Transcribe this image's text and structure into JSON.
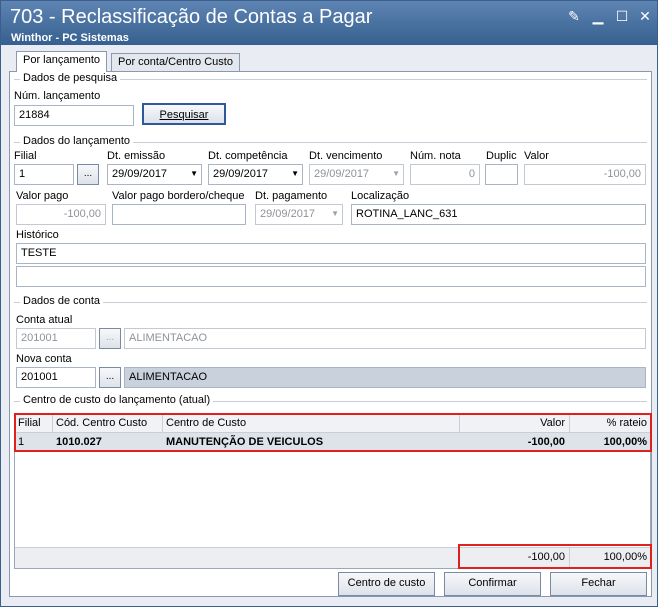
{
  "window": {
    "title": "703 - Reclassificação de Contas a Pagar",
    "subtitle": "Winthor - PC Sistemas"
  },
  "tabs": [
    {
      "label": "Por lançamento",
      "active": true
    },
    {
      "label": "Por conta/Centro Custo",
      "active": false
    }
  ],
  "pesquisa": {
    "group_label": "Dados de pesquisa",
    "num_lanc_label": "Núm. lançamento",
    "num_lanc_value": "21884",
    "search_button": "Pesquisar"
  },
  "lancamento": {
    "group_label": "Dados do lançamento",
    "filial_label": "Filial",
    "filial_value": "1",
    "dt_emissao_label": "Dt. emissão",
    "dt_emissao_value": "29/09/2017",
    "dt_competencia_label": "Dt. competência",
    "dt_competencia_value": "29/09/2017",
    "dt_vencimento_label": "Dt. vencimento",
    "dt_vencimento_value": "29/09/2017",
    "num_nota_label": "Núm. nota",
    "num_nota_value": "0",
    "duplic_label": "Duplic",
    "duplic_value": "",
    "valor_label": "Valor",
    "valor_value": "-100,00",
    "valor_pago_label": "Valor pago",
    "valor_pago_value": "-100,00",
    "valor_bordero_label": "Valor pago bordero/cheque",
    "valor_bordero_value": "",
    "dt_pagamento_label": "Dt. pagamento",
    "dt_pagamento_value": "29/09/2017",
    "localizacao_label": "Localização",
    "localizacao_value": "ROTINA_LANC_631",
    "historico_label": "Histórico",
    "historico_value": "TESTE",
    "historico2_value": "",
    "ellipsis": "..."
  },
  "conta": {
    "group_label": "Dados de conta",
    "conta_atual_label": "Conta atual",
    "conta_atual_code": "201001",
    "conta_atual_name": "ALIMENTACAO",
    "nova_conta_label": "Nova conta",
    "nova_conta_code": "201001",
    "nova_conta_name": "ALIMENTACAO",
    "ellipsis": "..."
  },
  "centro_custo": {
    "group_label": "Centro de custo do lançamento (atual)",
    "columns": [
      "Filial",
      "Cód. Centro Custo",
      "Centro de Custo",
      "Valor",
      "% rateio"
    ],
    "rows": [
      {
        "filial": "1",
        "codigo": "1010.027",
        "centro": "MANUTENÇÃO DE VEICULOS",
        "valor": "-100,00",
        "rateio": "100,00%"
      }
    ],
    "total_valor": "-100,00",
    "total_rateio": "100,00%"
  },
  "buttons": {
    "centro_custo": "Centro de custo",
    "confirmar": "Confirmar",
    "fechar": "Fechar"
  },
  "colors": {
    "highlight": "#e0201c",
    "title_bar": "#4a719f"
  }
}
